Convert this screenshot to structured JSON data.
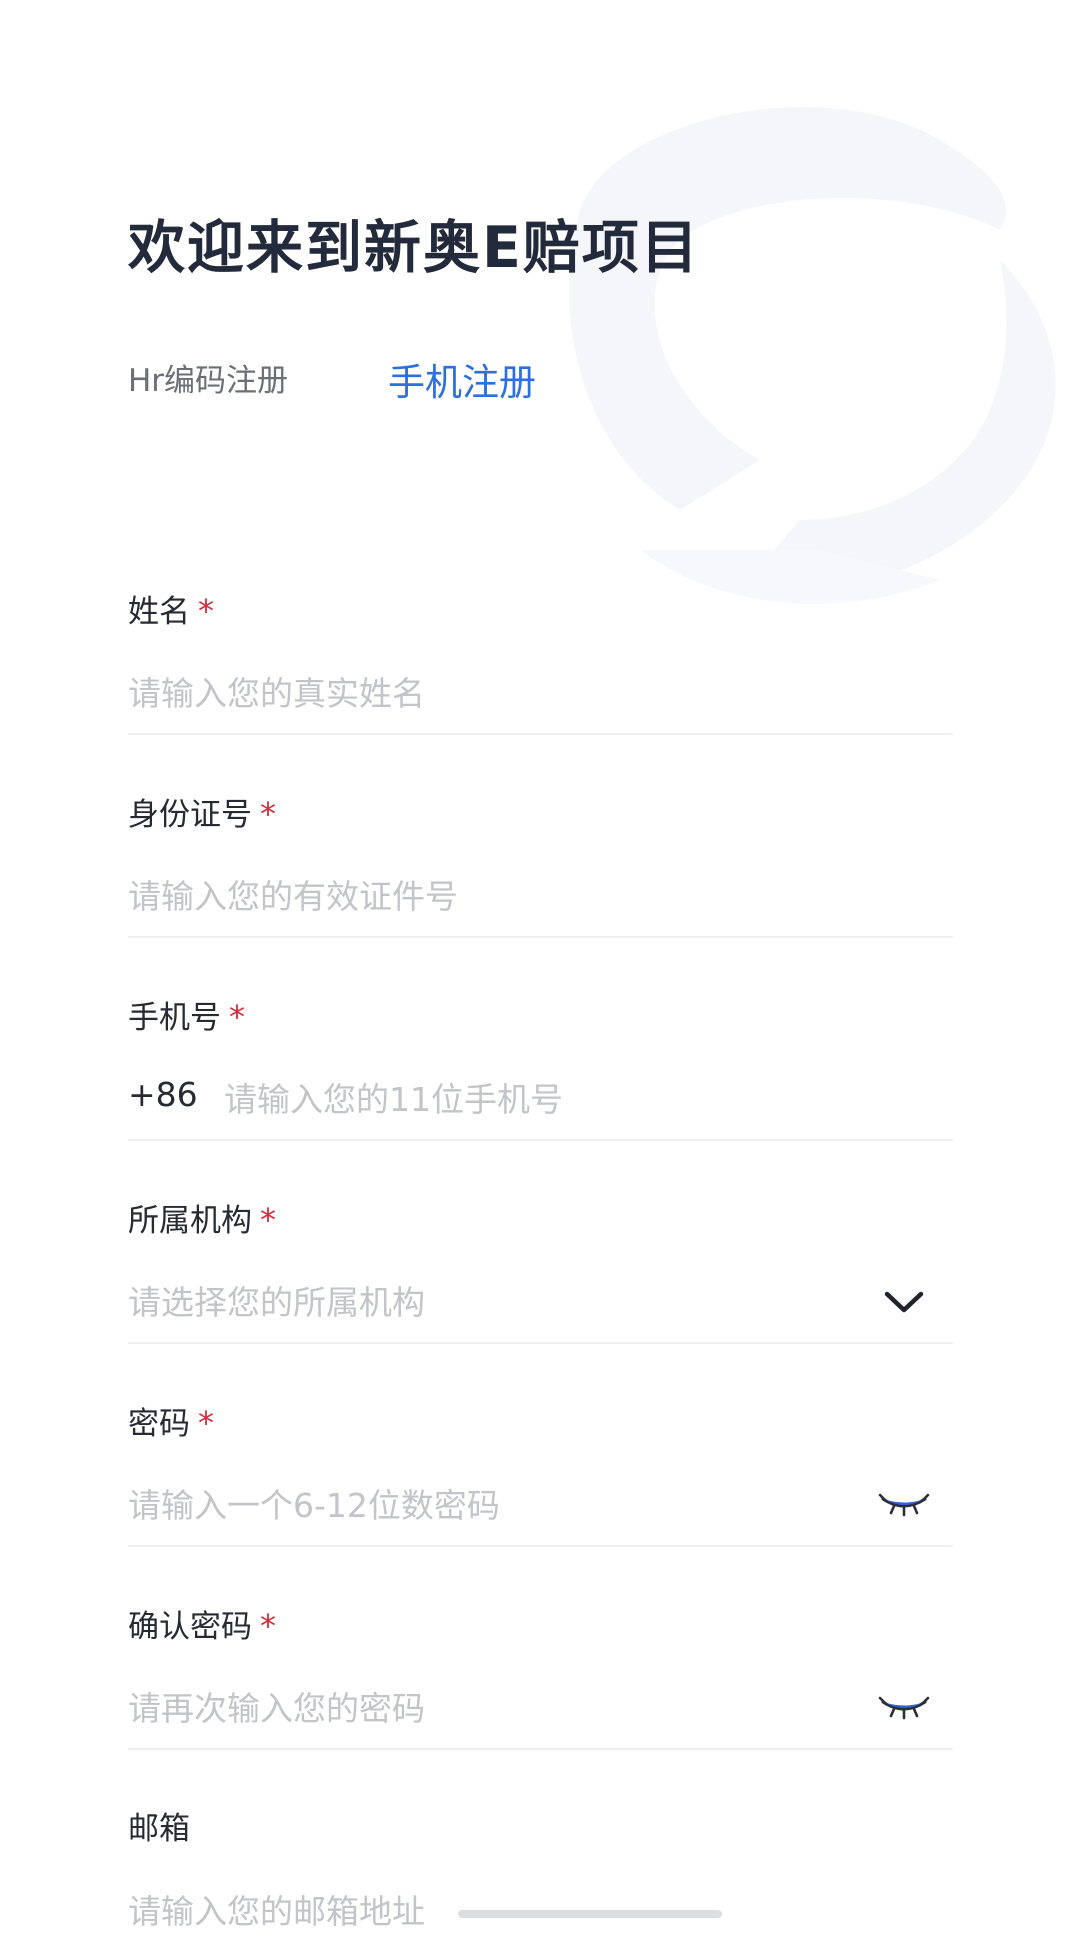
{
  "header": {
    "title": "欢迎来到新奥E赔项目"
  },
  "tabs": [
    {
      "label": "Hr编码注册",
      "active": false
    },
    {
      "label": "手机注册",
      "active": true
    }
  ],
  "form": {
    "required_mark": "*",
    "fields": {
      "name": {
        "label": "姓名",
        "required": true,
        "value": "",
        "placeholder": "请输入您的真实姓名"
      },
      "id_number": {
        "label": "身份证号",
        "required": true,
        "value": "",
        "placeholder": "请输入您的有效证件号"
      },
      "phone": {
        "label": "手机号",
        "required": true,
        "prefix": "+86",
        "value": "",
        "placeholder": "请输入您的11位手机号"
      },
      "organization": {
        "label": "所属机构",
        "required": true,
        "value": "",
        "placeholder": "请选择您的所属机构",
        "icon": "chevron-down-icon"
      },
      "password": {
        "label": "密码",
        "required": true,
        "value": "",
        "placeholder": "请输入一个6-12位数密码",
        "icon": "eye-closed-icon"
      },
      "confirm_password": {
        "label": "确认密码",
        "required": true,
        "value": "",
        "placeholder": "请再次输入您的密码",
        "icon": "eye-closed-icon"
      },
      "email": {
        "label": "邮箱",
        "required": false,
        "value": "",
        "placeholder": "请输入您的邮箱地址"
      }
    }
  },
  "colors": {
    "accent": "#2c6fe0",
    "required": "#d42d3c",
    "title": "#232a3b",
    "placeholder": "#c2c4c9",
    "divider": "#eef0f3",
    "watermark": "#f3f6fb"
  }
}
